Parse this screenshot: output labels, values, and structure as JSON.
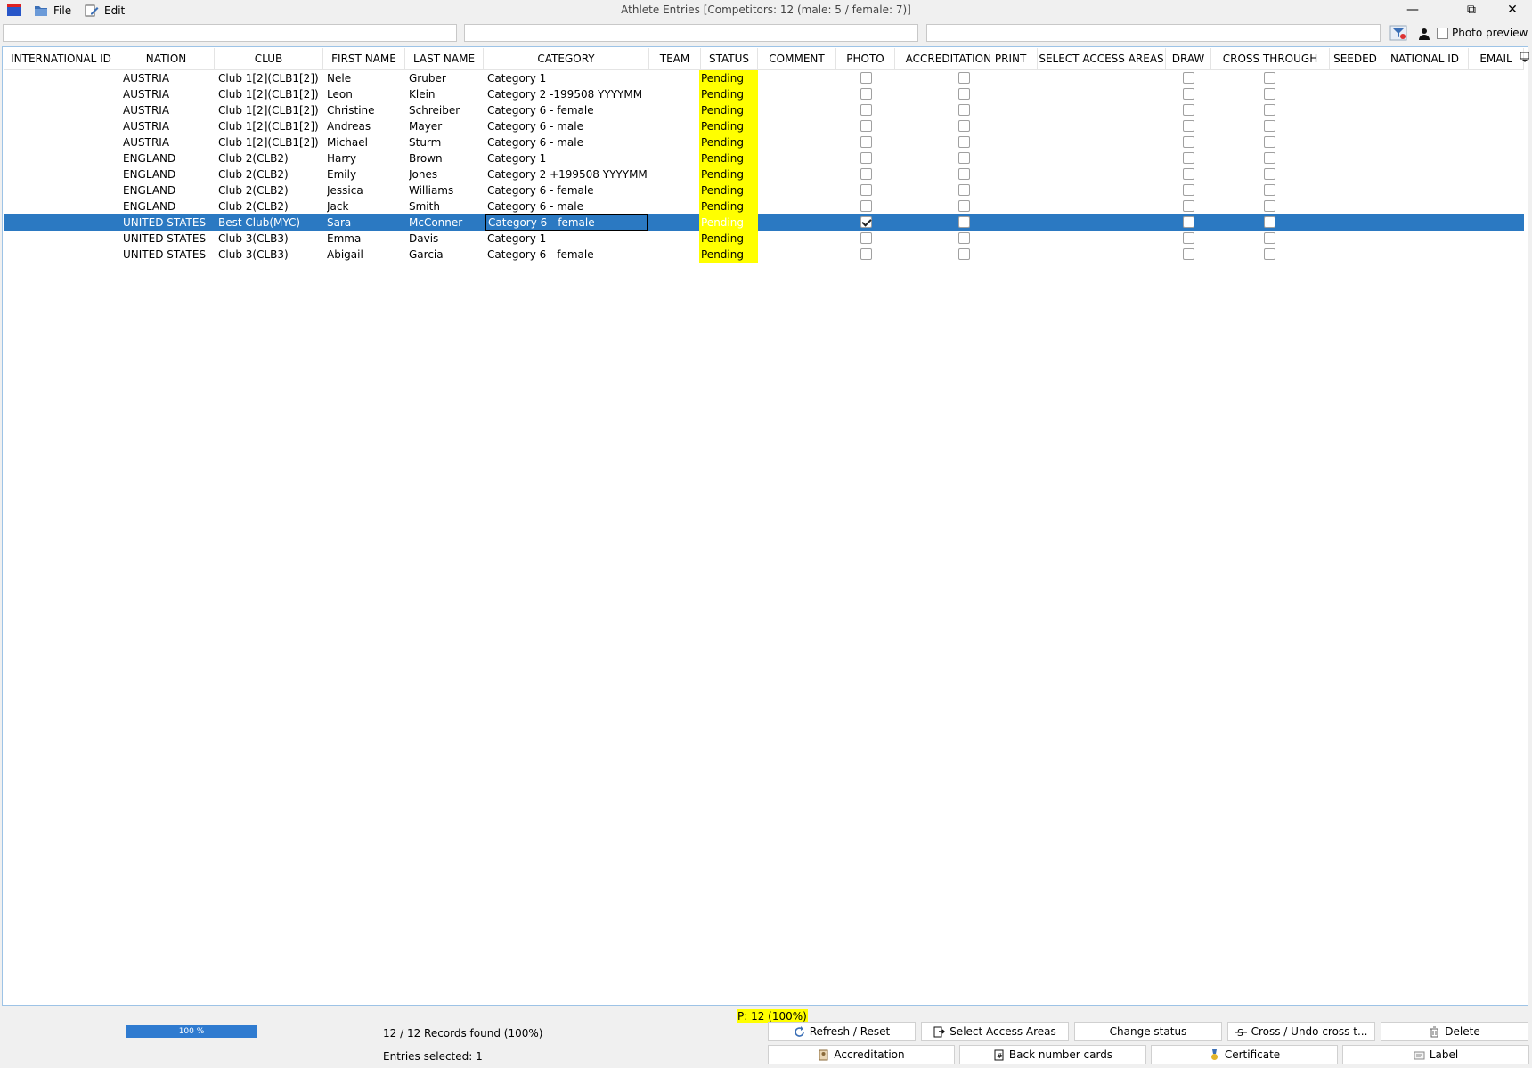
{
  "window": {
    "title": "Athlete Entries [Competitors: 12 (male: 5 / female: 7)]",
    "menu": [
      {
        "label": "File",
        "icon": "folder-icon"
      },
      {
        "label": "Edit",
        "icon": "edit-icon"
      }
    ]
  },
  "filters": {
    "photo_preview_label": "Photo preview",
    "photo_preview_checked": false
  },
  "grid": {
    "columns": [
      "INTERNATIONAL ID",
      "NATION",
      "CLUB",
      "FIRST NAME",
      "LAST NAME",
      "CATEGORY",
      "TEAM",
      "STATUS",
      "COMMENT",
      "PHOTO",
      "ACCREDITATION PRINT",
      "SELECT ACCESS AREAS",
      "DRAW",
      "CROSS THROUGH",
      "SEEDED",
      "NATIONAL ID",
      "EMAIL"
    ],
    "rows": [
      {
        "nation": "AUSTRIA",
        "club": "Club 1[2](CLB1[2])",
        "first": "Nele",
        "last": "Gruber",
        "category": "Category 1",
        "status": "Pending",
        "photo": false,
        "accreditation": false,
        "draw": false,
        "cross": false
      },
      {
        "nation": "AUSTRIA",
        "club": "Club 1[2](CLB1[2])",
        "first": "Leon",
        "last": "Klein",
        "category": "Category 2 -199508 YYYYMM",
        "status": "Pending",
        "photo": false,
        "accreditation": false,
        "draw": false,
        "cross": false
      },
      {
        "nation": "AUSTRIA",
        "club": "Club 1[2](CLB1[2])",
        "first": "Christine",
        "last": "Schreiber",
        "category": "Category 6 - female",
        "status": "Pending",
        "photo": false,
        "accreditation": false,
        "draw": false,
        "cross": false
      },
      {
        "nation": "AUSTRIA",
        "club": "Club 1[2](CLB1[2])",
        "first": "Andreas",
        "last": "Mayer",
        "category": "Category 6 - male",
        "status": "Pending",
        "photo": false,
        "accreditation": false,
        "draw": false,
        "cross": false
      },
      {
        "nation": "AUSTRIA",
        "club": "Club 1[2](CLB1[2])",
        "first": "Michael",
        "last": "Sturm",
        "category": "Category 6 - male",
        "status": "Pending",
        "photo": false,
        "accreditation": false,
        "draw": false,
        "cross": false
      },
      {
        "nation": "ENGLAND",
        "club": "Club 2(CLB2)",
        "first": "Harry",
        "last": "Brown",
        "category": "Category 1",
        "status": "Pending",
        "photo": false,
        "accreditation": false,
        "draw": false,
        "cross": false
      },
      {
        "nation": "ENGLAND",
        "club": "Club 2(CLB2)",
        "first": "Emily",
        "last": "Jones",
        "category": "Category 2 +199508 YYYYMM",
        "status": "Pending",
        "photo": false,
        "accreditation": false,
        "draw": false,
        "cross": false
      },
      {
        "nation": "ENGLAND",
        "club": "Club 2(CLB2)",
        "first": "Jessica",
        "last": "Williams",
        "category": "Category 6 - female",
        "status": "Pending",
        "photo": false,
        "accreditation": false,
        "draw": false,
        "cross": false
      },
      {
        "nation": "ENGLAND",
        "club": "Club 2(CLB2)",
        "first": "Jack",
        "last": "Smith",
        "category": "Category 6 - male",
        "status": "Pending",
        "photo": false,
        "accreditation": false,
        "draw": false,
        "cross": false
      },
      {
        "nation": "UNITED STATES",
        "club": "Best Club(MYC)",
        "first": "Sara",
        "last": "McConner",
        "category": "Category 6 - female",
        "status": "Pending",
        "photo": true,
        "accreditation": false,
        "draw": false,
        "cross": false,
        "selected": true
      },
      {
        "nation": "UNITED STATES",
        "club": "Club 3(CLB3)",
        "first": "Emma",
        "last": "Davis",
        "category": "Category 1",
        "status": "Pending",
        "photo": false,
        "accreditation": false,
        "draw": false,
        "cross": false
      },
      {
        "nation": "UNITED STATES",
        "club": "Club 3(CLB3)",
        "first": "Abigail",
        "last": "Garcia",
        "category": "Category 6 - female",
        "status": "Pending",
        "photo": false,
        "accreditation": false,
        "draw": false,
        "cross": false
      }
    ]
  },
  "status": {
    "pending_count": "P: 12 (100%)",
    "progress_label": "100 %",
    "progress_fraction": 1.0,
    "records_found": "12 / 12 Records found (100%)",
    "entries_selected": "Entries selected: 1"
  },
  "buttons": {
    "refresh": "Refresh / Reset",
    "select_access": "Select Access Areas",
    "change_status": "Change status",
    "cross": "Cross / Undo cross t...",
    "delete": "Delete",
    "accreditation": "Accreditation",
    "back_number": "Back number cards",
    "certificate": "Certificate",
    "label": "Label"
  },
  "colors": {
    "selection": "#2b79c2",
    "status_highlight": "#ffff00",
    "progress": "#2f7bd0"
  }
}
